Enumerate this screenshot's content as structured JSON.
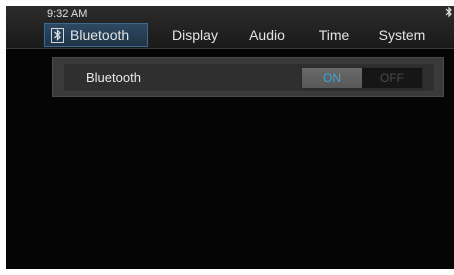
{
  "status": {
    "time": "9:32 AM",
    "bluetooth_icon": "bluetooth-icon"
  },
  "tabs": [
    {
      "label": "Bluetooth",
      "icon": "bluetooth-icon",
      "active": true
    },
    {
      "label": "Display"
    },
    {
      "label": "Audio"
    },
    {
      "label": "Time"
    },
    {
      "label": "System"
    }
  ],
  "settings": {
    "bluetooth": {
      "label": "Bluetooth",
      "on_label": "ON",
      "off_label": "OFF",
      "value": "ON"
    }
  },
  "colors": {
    "active_tab": "#2d4a63",
    "toggle_on_text": "#3aa6e0"
  }
}
